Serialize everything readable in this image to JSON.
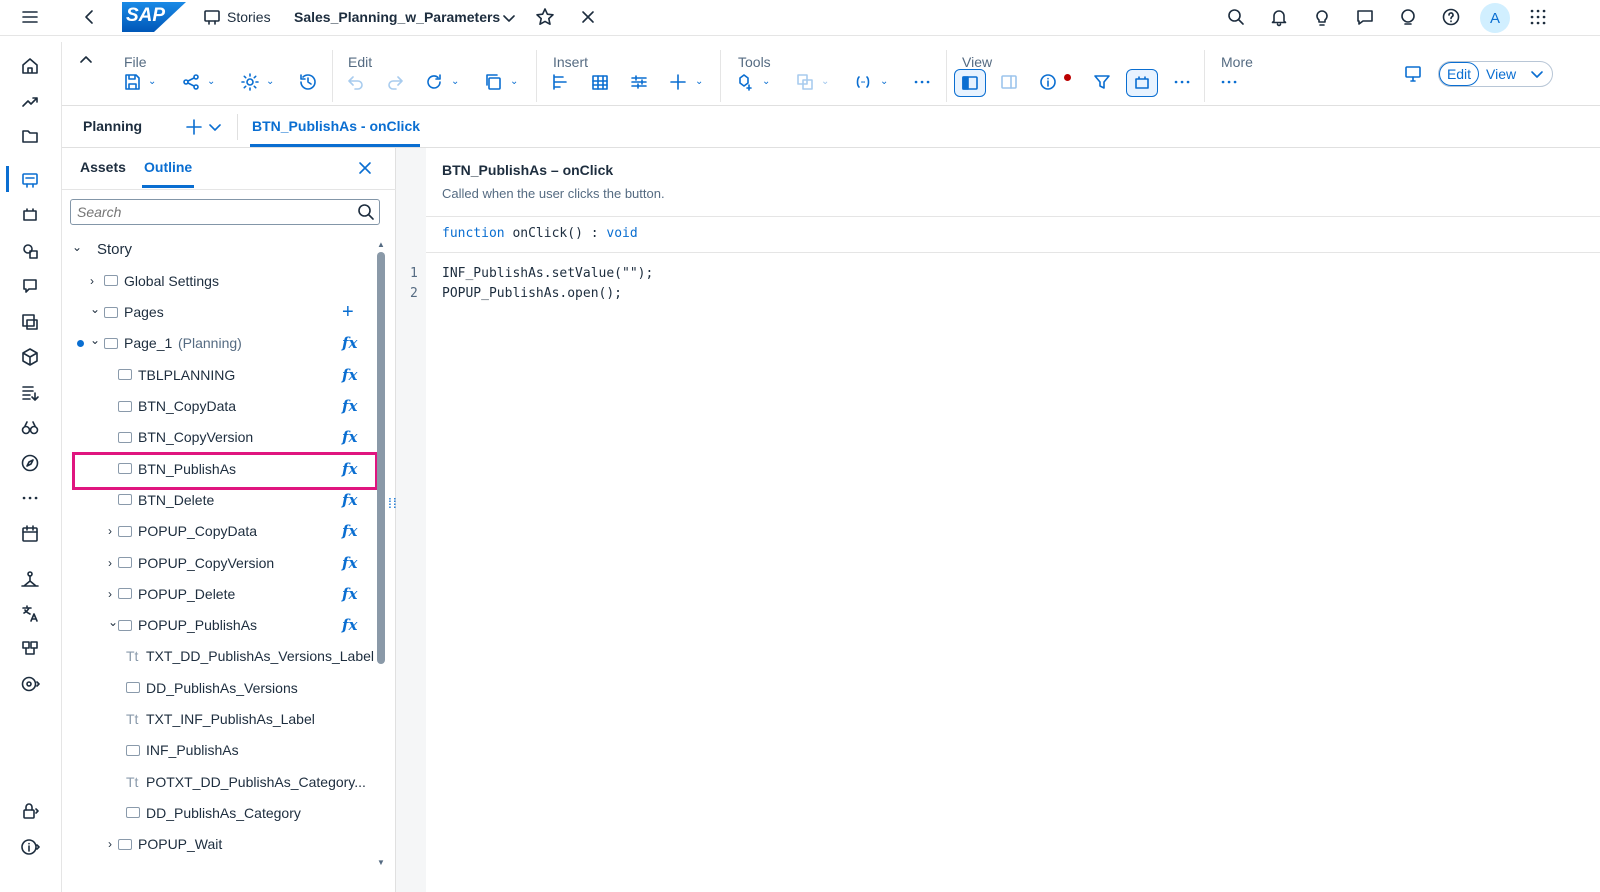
{
  "shell": {
    "breadcrumb_app": "Stories",
    "story_title": "Sales_Planning_w_Parameters",
    "logo": "SAP",
    "avatar": "A"
  },
  "toolbar": {
    "groups": [
      "File",
      "Edit",
      "Insert",
      "Tools",
      "View",
      "More"
    ],
    "edit_label": "Edit",
    "view_label": "View"
  },
  "tabs": {
    "planning": "Planning",
    "active": "BTN_PublishAs - onClick"
  },
  "outline": {
    "tab_assets": "Assets",
    "tab_outline": "Outline",
    "search_placeholder": "Search",
    "items": [
      {
        "label": "Story",
        "indent": 0,
        "chev": "v"
      },
      {
        "label": "Global Settings",
        "indent": 1,
        "chev": ">"
      },
      {
        "label": "Pages",
        "indent": 1,
        "chev": "v"
      },
      {
        "label": "Page_1",
        "suffix": "(Planning)",
        "indent": 1,
        "chev": "v"
      },
      {
        "label": "TBLPLANNING",
        "indent": 2
      },
      {
        "label": "BTN_CopyData",
        "indent": 2
      },
      {
        "label": "BTN_CopyVersion",
        "indent": 2
      },
      {
        "label": "BTN_PublishAs",
        "indent": 2,
        "selected": true
      },
      {
        "label": "BTN_Delete",
        "indent": 2
      },
      {
        "label": "POPUP_CopyData",
        "indent": 2,
        "chev": ">"
      },
      {
        "label": "POPUP_CopyVersion",
        "indent": 2,
        "chev": ">"
      },
      {
        "label": "POPUP_Delete",
        "indent": 2,
        "chev": ">"
      },
      {
        "label": "POPUP_PublishAs",
        "indent": 2,
        "chev": "v"
      },
      {
        "label": "TXT_DD_PublishAs_Versions_Label",
        "indent": 3
      },
      {
        "label": "DD_PublishAs_Versions",
        "indent": 3
      },
      {
        "label": "TXT_INF_PublishAs_Label",
        "indent": 3
      },
      {
        "label": "INF_PublishAs",
        "indent": 3
      },
      {
        "label": "POTXT_DD_PublishAs_Category...",
        "indent": 3
      },
      {
        "label": "DD_PublishAs_Category",
        "indent": 3
      },
      {
        "label": "POPUP_Wait",
        "indent": 2,
        "chev": ">"
      }
    ]
  },
  "editor": {
    "title": "BTN_PublishAs – onClick",
    "description": "Called when the user clicks the button.",
    "sig_kw": "function",
    "sig_name": "onClick() :",
    "sig_type": "void",
    "lines": [
      "INF_PublishAs.setValue(\"\");",
      "POPUP_PublishAs.open();"
    ],
    "line_numbers": [
      "1",
      "2"
    ]
  },
  "colors": {
    "accent": "#0a6ed1",
    "highlight": "#e0157f"
  }
}
